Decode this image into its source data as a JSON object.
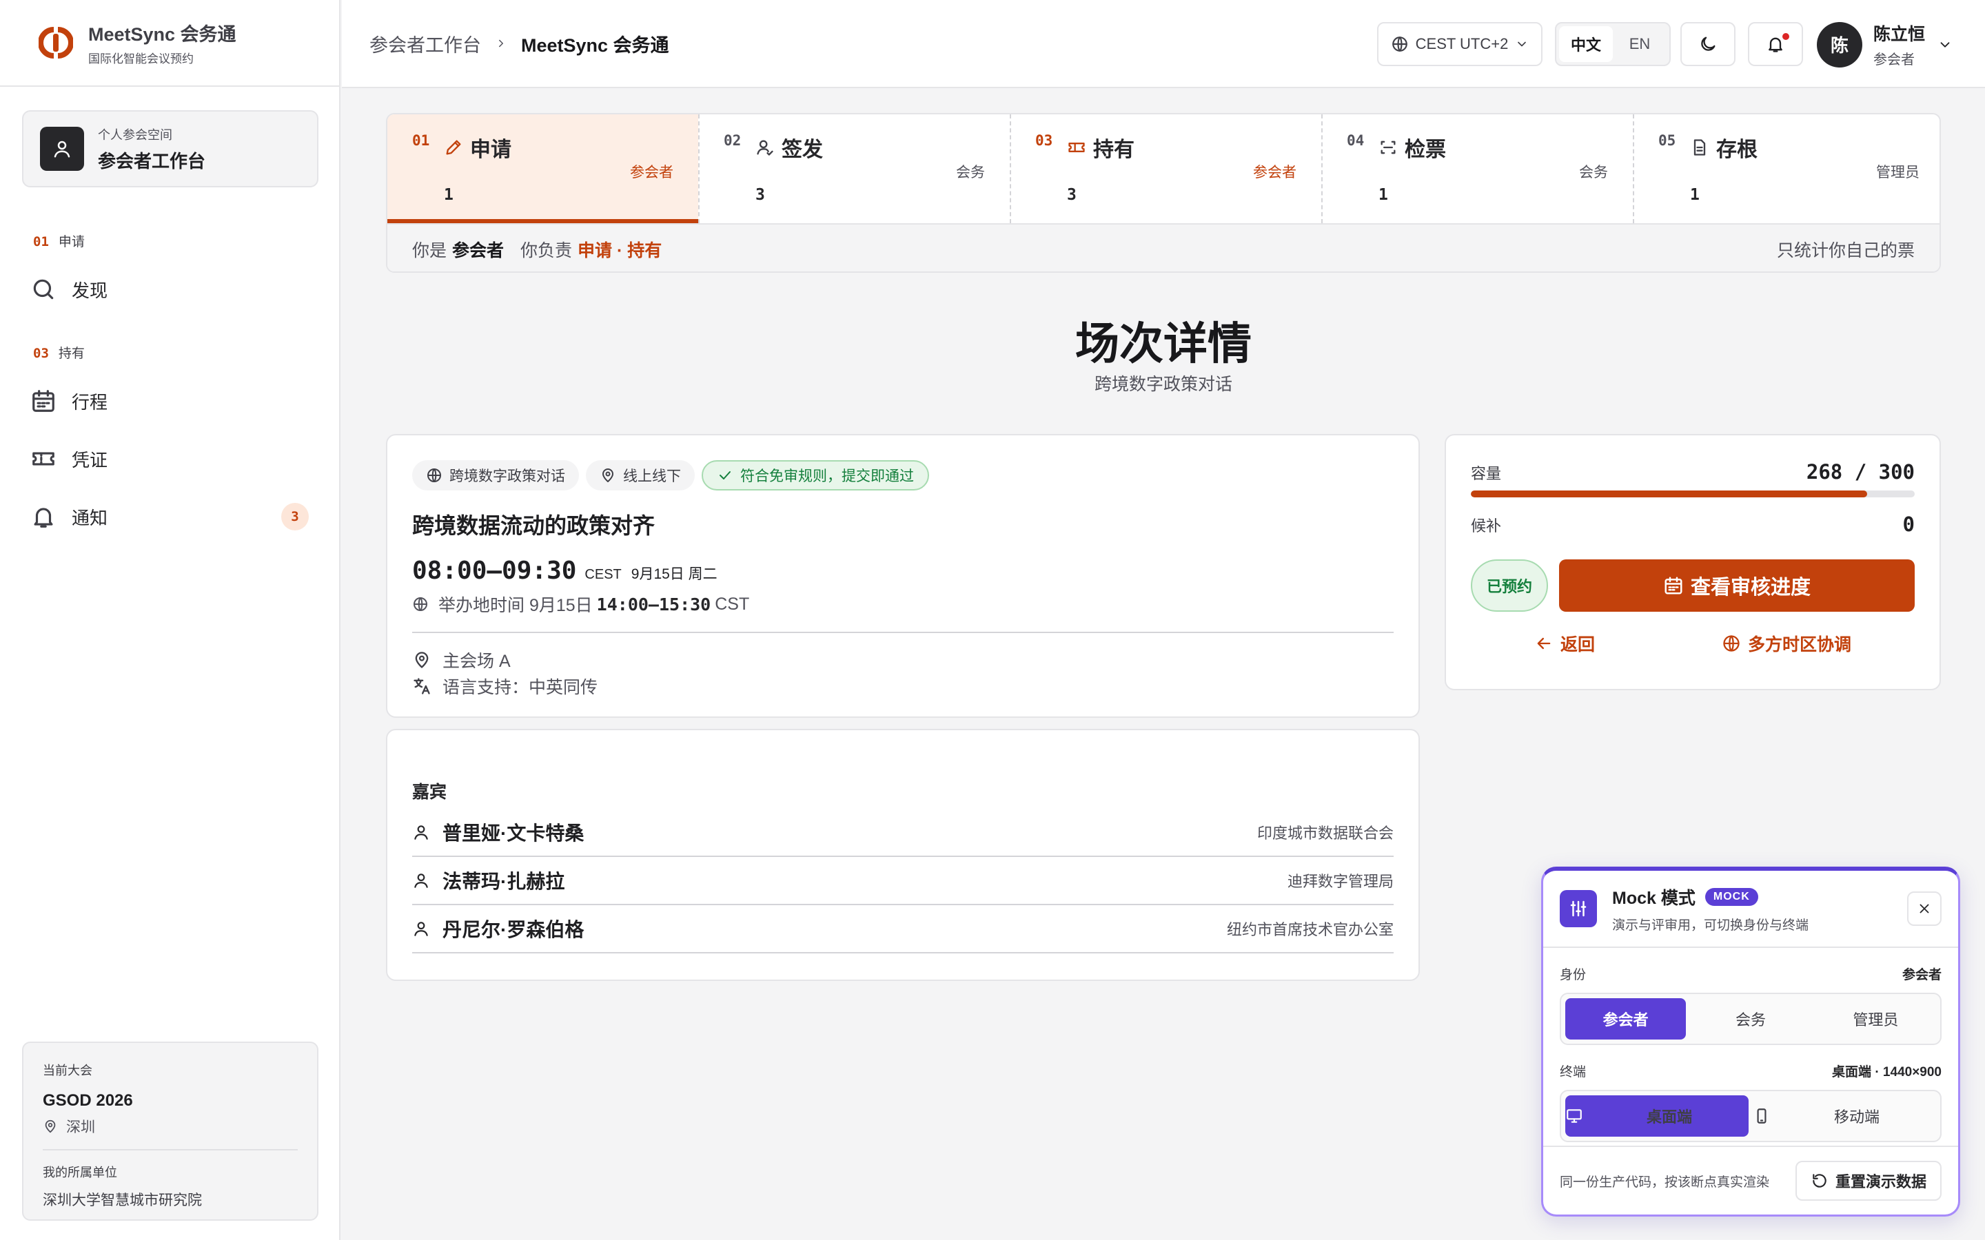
{
  "brand": {
    "name": "MeetSync 会务通",
    "subtitle": "国际化智能会议预约"
  },
  "workspace": {
    "kicker": "个人参会空间",
    "title": "参会者工作台"
  },
  "sidebar": {
    "groups": [
      {
        "num": "01",
        "label": "申请"
      },
      {
        "num": "03",
        "label": "持有"
      }
    ],
    "items": [
      {
        "label": "发现",
        "icon": "search-icon"
      },
      {
        "label": "行程",
        "icon": "calendar-icon"
      },
      {
        "label": "凭证",
        "icon": "ticket-icon"
      },
      {
        "label": "通知",
        "icon": "bell-icon",
        "badge": "3"
      }
    ]
  },
  "conference": {
    "label": "当前大会",
    "name": "GSOD 2026",
    "city": "深圳",
    "org_label": "我的所属单位",
    "org": "深圳大学智慧城市研究院"
  },
  "header": {
    "breadcrumb": [
      "参会者工作台",
      "MeetSync 会务通"
    ],
    "timezone": "CEST UTC+2",
    "lang": [
      "中文",
      "EN"
    ],
    "user_name": "陈立恒",
    "user_role": "参会者",
    "avatar": "陈"
  },
  "steps": [
    {
      "num": "01",
      "title": "申请",
      "role": "参会者",
      "count": "1",
      "icon": "pencil-icon"
    },
    {
      "num": "02",
      "title": "签发",
      "role": "会务",
      "count": "3",
      "icon": "user-check-icon"
    },
    {
      "num": "03",
      "title": "持有",
      "role": "参会者",
      "count": "3",
      "icon": "ticket-icon"
    },
    {
      "num": "04",
      "title": "检票",
      "role": "会务",
      "count": "1",
      "icon": "scan-icon"
    },
    {
      "num": "05",
      "title": "存根",
      "role": "管理员",
      "count": "1",
      "icon": "file-icon"
    }
  ],
  "steps_bar": {
    "you_are": "你是",
    "role": "参会者",
    "responsible": "你负责",
    "duties": "申请 · 持有",
    "note": "只统计你自己的票"
  },
  "page": {
    "title": "场次详情",
    "subtitle": "跨境数字政策对话"
  },
  "session": {
    "tags": [
      "跨境数字政策对话",
      "线上线下",
      "符合免审规则，提交即通过"
    ],
    "title": "跨境数据流动的政策对齐",
    "time": "08:00–09:30",
    "tz": "CEST",
    "date": "9月15日 周二",
    "host_prefix": "举办地时间 9月15日",
    "host_time": "14:00–15:30",
    "host_tz": "CST",
    "venue": "主会场 A",
    "language": "语言支持：中英同传"
  },
  "guests": {
    "label": "嘉宾",
    "list": [
      {
        "name": "普里娅·文卡特桑",
        "org": "印度城市数据联合会"
      },
      {
        "name": "法蒂玛·扎赫拉",
        "org": "迪拜数字管理局"
      },
      {
        "name": "丹尼尔·罗森伯格",
        "org": "纽约市首席技术官办公室"
      }
    ]
  },
  "capacity": {
    "label": "容量",
    "value": "268 / 300",
    "filled": 268,
    "total": 300,
    "waitlist_label": "候补",
    "waitlist": "0",
    "booked": "已预约",
    "primary": "查看审核进度",
    "back": "返回",
    "tz_link": "多方时区协调"
  },
  "mock": {
    "title": "Mock 模式",
    "badge": "MOCK",
    "subtitle": "演示与评审用，可切换身份与终端",
    "identity_label": "身份",
    "identity_value": "参会者",
    "identities": [
      "参会者",
      "会务",
      "管理员"
    ],
    "terminal_label": "终端",
    "terminal_value": "桌面端 · 1440×900",
    "terminals": [
      "桌面端",
      "移动端"
    ],
    "footer": "同一份生产代码，按该断点真实渲染",
    "reset": "重置演示数据"
  },
  "colors": {
    "accent": "#c2410c",
    "mock": "#5b3fd6",
    "success": "#15803d"
  }
}
